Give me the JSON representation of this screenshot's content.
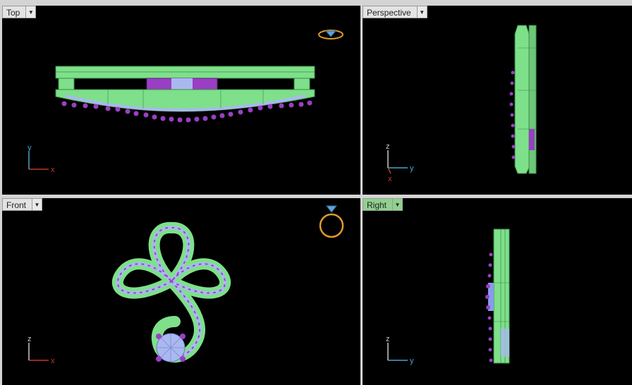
{
  "viewports": {
    "top": {
      "label": "Top",
      "axis_v": "y",
      "axis_h": "x"
    },
    "perspective": {
      "label": "Perspective",
      "axis_v": "z",
      "axis_h": "y",
      "axis_d": "x"
    },
    "front": {
      "label": "Front",
      "axis_v": "z",
      "axis_h": "x"
    },
    "right": {
      "label": "Right",
      "axis_v": "z",
      "axis_h": "y",
      "active": true
    }
  },
  "icons": {
    "dropdown": "chevron-down-icon",
    "ring": "ring-icon"
  },
  "colors": {
    "viewport_bg": "#000000",
    "metal": "#7ee08a",
    "metal_edge": "#3a8a45",
    "stone": "#aab8f0",
    "prong": "#9a3fc4",
    "axis_x": "#c0392b",
    "axis_y": "#4aa3d0",
    "active_tab": "#8fd18f"
  }
}
